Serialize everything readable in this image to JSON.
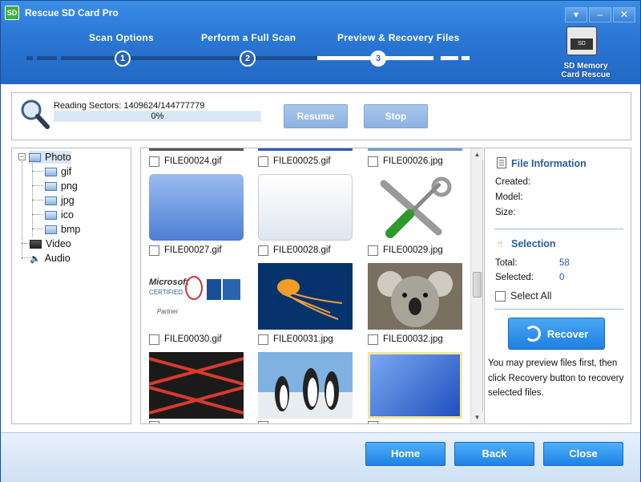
{
  "app": {
    "title": "Rescue SD Card Pro",
    "icon": "sd-app-icon"
  },
  "window_controls": [
    "▾",
    "–",
    "✕"
  ],
  "steps": [
    {
      "label": "Scan Options",
      "number": "1",
      "state": "done"
    },
    {
      "label": "Perform a Full Scan",
      "number": "2",
      "state": "done"
    },
    {
      "label": "Preview & Recovery Files",
      "number": "3",
      "state": "current"
    }
  ],
  "brand": {
    "caption_line1": "SD Memory",
    "caption_line2": "Card Rescue",
    "card_text": "SD"
  },
  "scan": {
    "reading_label": "Reading Sectors:",
    "reading_value": "1409624/144777779",
    "progress_text": "0%",
    "progress_fraction": 0.0,
    "resume_label": "Resume",
    "stop_label": "Stop"
  },
  "tree": {
    "photo": "Photo",
    "photo_children": [
      "gif",
      "png",
      "jpg",
      "ico",
      "bmp"
    ],
    "video": "Video",
    "audio": "Audio"
  },
  "files": [
    {
      "name": "FILE00024.gif"
    },
    {
      "name": "FILE00025.gif"
    },
    {
      "name": "FILE00026.jpg"
    },
    {
      "name": "FILE00027.gif"
    },
    {
      "name": "FILE00028.gif"
    },
    {
      "name": "FILE00029.jpg"
    },
    {
      "name": "FILE00030.gif"
    },
    {
      "name": "FILE00031.jpg"
    },
    {
      "name": "FILE00032.jpg"
    }
  ],
  "thumb_logo": {
    "line1": "Microsoft",
    "line2": "CERTIFIED",
    "line3": "Partner"
  },
  "file_info": {
    "title": "File Information",
    "created_label": "Created:",
    "model_label": "Model:",
    "size_label": "Size:"
  },
  "selection": {
    "title": "Selection",
    "total_label": "Total:",
    "total_value": "58",
    "selected_label": "Selected:",
    "selected_value": "0",
    "select_all_label": "Select All"
  },
  "recover": {
    "label": "Recover",
    "note": "You may preview files first, then click Recovery button to recovery selected files."
  },
  "footer": {
    "home": "Home",
    "back": "Back",
    "close": "Close"
  },
  "colors": {
    "header": "#2b78d6",
    "accent": "#1e82e6",
    "section_title": "#2a5c9e"
  }
}
